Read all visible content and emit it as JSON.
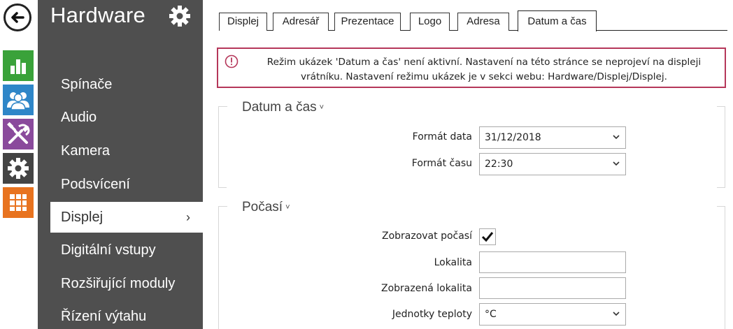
{
  "rail": {
    "back_icon": "arrow-left-icon",
    "items": [
      {
        "icon": "chart-bars-icon",
        "color": "#3aa23a"
      },
      {
        "icon": "users-icon",
        "color": "#2e86c8"
      },
      {
        "icon": "tools-icon",
        "color": "#8a4a9c"
      },
      {
        "icon": "gear-icon",
        "color": "#444444"
      },
      {
        "icon": "grid-icon",
        "color": "#e8731f"
      }
    ]
  },
  "sidebar": {
    "title": "Hardware",
    "items": [
      {
        "label": "Spínače"
      },
      {
        "label": "Audio"
      },
      {
        "label": "Kamera"
      },
      {
        "label": "Podsvícení"
      },
      {
        "label": "Displej",
        "active": true,
        "chevron": "›"
      },
      {
        "label": "Digitální vstupy"
      },
      {
        "label": "Rozšiřující moduly"
      },
      {
        "label": "Řízení výtahu"
      }
    ]
  },
  "tabs": [
    {
      "label": "Displej"
    },
    {
      "label": "Adresář"
    },
    {
      "label": "Prezentace"
    },
    {
      "label": "Logo"
    },
    {
      "label": "Adresa"
    },
    {
      "label": "Datum a čas",
      "active": true
    }
  ],
  "alert": {
    "text": "Režim ukázek 'Datum a čas' není aktivní. Nastavení na této stránce se neprojeví na displeji vrátníku. Nastavení režimu ukázek je v sekci webu: Hardware/Displej/Displej.",
    "color": "#b5375a"
  },
  "section_datetime": {
    "title": "Datum a čas",
    "caret": "˅",
    "date_format_label": "Formát data",
    "date_format_value": "31/12/2018",
    "time_format_label": "Formát času",
    "time_format_value": "22:30"
  },
  "section_weather": {
    "title": "Počasí",
    "caret": "˅",
    "show_weather_label": "Zobrazovat počasí",
    "show_weather_checked": true,
    "location_label": "Lokalita",
    "location_value": "",
    "display_location_label": "Zobrazená lokalita",
    "display_location_value": "",
    "temp_units_label": "Jednotky teploty",
    "temp_units_value": "°C"
  }
}
